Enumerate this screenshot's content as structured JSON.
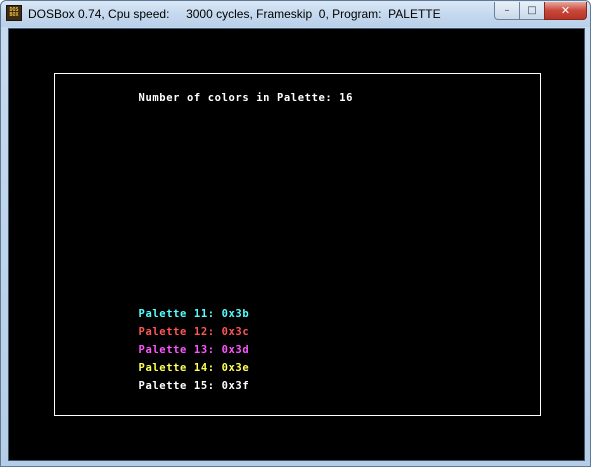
{
  "window": {
    "title": "DOSBox 0.74, Cpu speed:     3000 cycles, Frameskip  0, Program:  PALETTE",
    "icon_text": [
      "DOS",
      "BOX"
    ],
    "controls": {
      "minimize": "–",
      "maximize": "□",
      "close": "✕"
    }
  },
  "dos": {
    "heading": "Number of colors in Palette: 16",
    "palette_lines": [
      {
        "label": "Palette 11: ",
        "value": "0x3b",
        "color": "#55ffff"
      },
      {
        "label": "Palette 12: ",
        "value": "0x3c",
        "color": "#ff5555"
      },
      {
        "label": "Palette 13: ",
        "value": "0x3d",
        "color": "#ff55ff"
      },
      {
        "label": "Palette 14: ",
        "value": "0x3e",
        "color": "#ffff55"
      },
      {
        "label": "Palette 15: ",
        "value": "0x3f",
        "color": "#ffffff"
      }
    ],
    "heading_color": "#ffffff",
    "frame_color": "#ffffff",
    "background": "#000000"
  }
}
